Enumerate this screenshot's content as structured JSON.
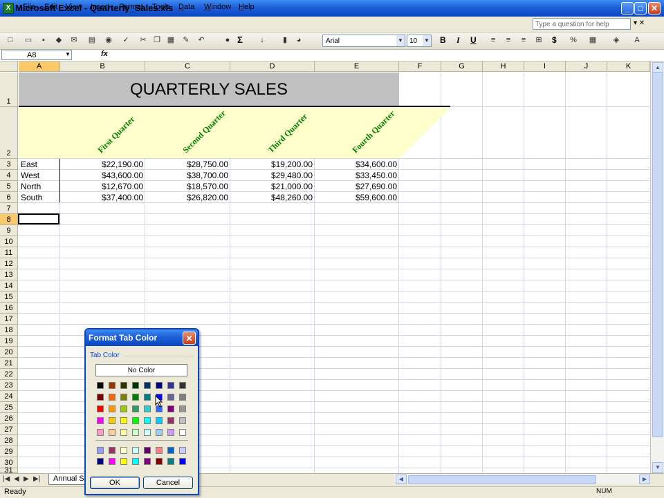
{
  "window": {
    "title": "Microsoft Excel - Quarterly_Sales.xls",
    "app_icon": "X",
    "min": "_",
    "max": "□",
    "close": "✕"
  },
  "menu": {
    "items": [
      {
        "label": "File",
        "u": "F",
        "rest": "ile"
      },
      {
        "label": "Edit",
        "u": "E",
        "rest": "dit"
      },
      {
        "label": "View",
        "u": "V",
        "rest": "iew"
      },
      {
        "label": "Insert",
        "u": "I",
        "rest": "nsert"
      },
      {
        "label": "Format",
        "pre": "F",
        "u": "o",
        "rest": "rmat"
      },
      {
        "label": "Tools",
        "u": "T",
        "rest": "ools"
      },
      {
        "label": "Data",
        "u": "D",
        "rest": "ata"
      },
      {
        "label": "Window",
        "u": "W",
        "rest": "indow"
      },
      {
        "label": "Help",
        "u": "H",
        "rest": "elp"
      }
    ],
    "ask_placeholder": "Type a question for help"
  },
  "toolbar": {
    "font": "Arial",
    "size": "10",
    "bold": "B",
    "italic": "I",
    "underline": "U",
    "currency": "$",
    "sigma": "Σ"
  },
  "formula": {
    "namebox": "A8",
    "fx": "fx",
    "content": ""
  },
  "columns": [
    "A",
    "B",
    "C",
    "D",
    "E",
    "F",
    "G",
    "H",
    "I",
    "J",
    "K"
  ],
  "rows": [
    "1",
    "2",
    "3",
    "4",
    "5",
    "6",
    "7",
    "8",
    "9",
    "10",
    "11",
    "12",
    "13",
    "14",
    "15",
    "16",
    "17",
    "18",
    "19",
    "20",
    "21",
    "22",
    "23",
    "24",
    "25",
    "26",
    "27",
    "28",
    "29",
    "30",
    "31"
  ],
  "sheet": {
    "title": "QUARTERLY SALES",
    "quarters": [
      "First Quarter",
      "Second Quarter",
      "Third Quarter",
      "Fourth Quarter"
    ],
    "regions": [
      "East",
      "West",
      "North",
      "South"
    ],
    "values": [
      [
        "$22,190.00",
        "$28,750.00",
        "$19,200.00",
        "$34,600.00"
      ],
      [
        "$43,600.00",
        "$38,700.00",
        "$29,480.00",
        "$33,450.00"
      ],
      [
        "$12,670.00",
        "$18,570.00",
        "$21,000.00",
        "$27,690.00"
      ],
      [
        "$37,400.00",
        "$26,820.00",
        "$48,260.00",
        "$59,600.00"
      ]
    ]
  },
  "tabs": {
    "sheet_tab": "Annual Sa"
  },
  "status": {
    "left": "Ready",
    "num": "NUM"
  },
  "dialog": {
    "title": "Format Tab Color",
    "group": "Tab Color",
    "no_color": "No Color",
    "ok": "OK",
    "cancel": "Cancel",
    "palette": [
      [
        "#000000",
        "#993300",
        "#333300",
        "#003300",
        "#003366",
        "#000080",
        "#333399",
        "#333333"
      ],
      [
        "#800000",
        "#FF6600",
        "#808000",
        "#008000",
        "#008080",
        "#0000FF",
        "#666699",
        "#808080"
      ],
      [
        "#FF0000",
        "#FF9900",
        "#99CC00",
        "#339966",
        "#33CCCC",
        "#3366FF",
        "#800080",
        "#969696"
      ],
      [
        "#FF00FF",
        "#FFCC00",
        "#FFFF00",
        "#00FF00",
        "#00FFFF",
        "#00CCFF",
        "#993366",
        "#C0C0C0"
      ],
      [
        "#FF99CC",
        "#FFCC99",
        "#FFFF99",
        "#CCFFCC",
        "#CCFFFF",
        "#99CCFF",
        "#CC99FF",
        "#FFFFFF"
      ]
    ],
    "palette_extra": [
      [
        "#9999FF",
        "#993366",
        "#FFFFCC",
        "#CCFFFF",
        "#660066",
        "#FF8080",
        "#0066CC",
        "#CCCCFF"
      ],
      [
        "#000080",
        "#FF00FF",
        "#FFFF00",
        "#00FFFF",
        "#800080",
        "#800000",
        "#008080",
        "#0000FF"
      ]
    ]
  }
}
